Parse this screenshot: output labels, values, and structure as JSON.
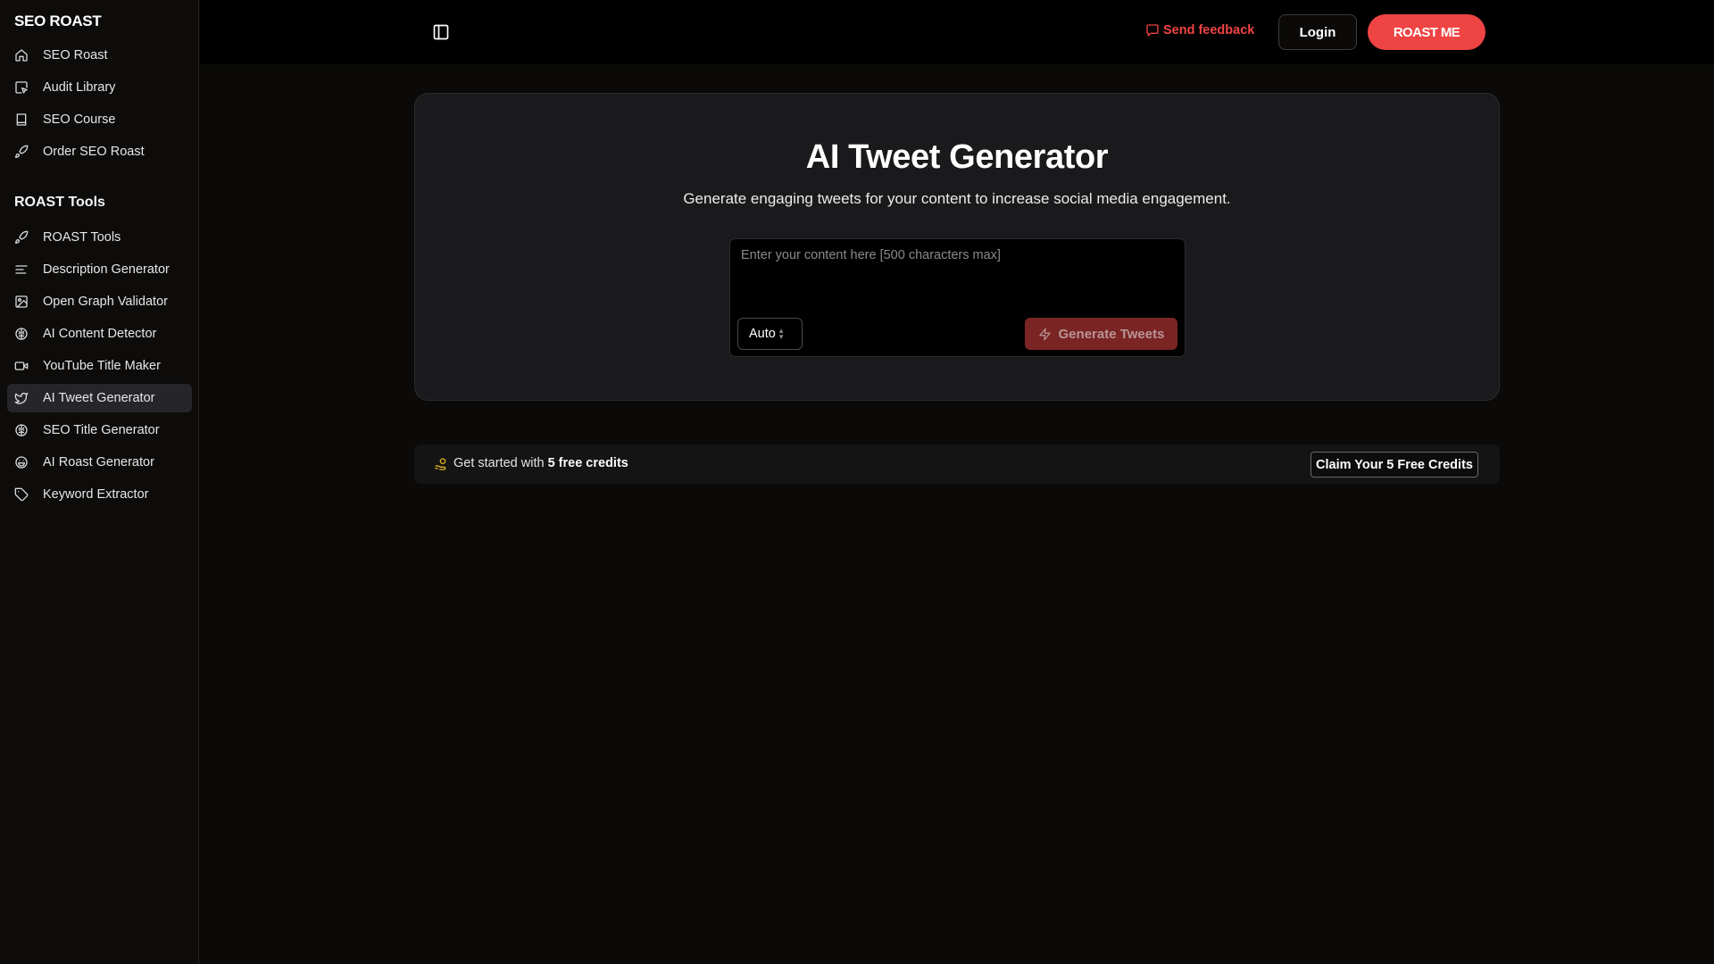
{
  "sidebar": {
    "brand": "SEO ROAST",
    "main_items": [
      {
        "label": "SEO Roast",
        "icon": "home-icon"
      },
      {
        "label": "Audit Library",
        "icon": "cursor-square-icon"
      },
      {
        "label": "SEO Course",
        "icon": "book-icon"
      },
      {
        "label": "Order SEO Roast",
        "icon": "rocket-icon"
      }
    ],
    "section_title": "ROAST Tools",
    "tool_items": [
      {
        "label": "ROAST Tools",
        "icon": "rocket-icon",
        "active": false
      },
      {
        "label": "Description Generator",
        "icon": "align-left-icon",
        "active": false
      },
      {
        "label": "Open Graph Validator",
        "icon": "image-icon",
        "active": false
      },
      {
        "label": "AI Content Detector",
        "icon": "brain-icon",
        "active": false
      },
      {
        "label": "YouTube Title Maker",
        "icon": "video-icon",
        "active": false
      },
      {
        "label": "AI Tweet Generator",
        "icon": "twitter-icon",
        "active": true
      },
      {
        "label": "SEO Title Generator",
        "icon": "brain-icon",
        "active": false
      },
      {
        "label": "AI Roast Generator",
        "icon": "laugh-icon",
        "active": false
      },
      {
        "label": "Keyword Extractor",
        "icon": "tag-icon",
        "active": false
      }
    ]
  },
  "header": {
    "toggle_icon": "sidebar-toggle-icon",
    "feedback_label": "Send feedback",
    "feedback_icon": "message-square-icon",
    "login_label": "Login",
    "cta_label": "ROAST ME"
  },
  "colors": {
    "accent": "#ef4444",
    "button_disabled": "#7a2424",
    "card_bg": "#1a1a1c",
    "page_bg": "#0b0a09",
    "coin": "#e0b020"
  },
  "tool": {
    "title": "AI Tweet Generator",
    "subtitle": "Generate engaging tweets for your content to increase social media engagement.",
    "input": {
      "value": "",
      "placeholder": "Enter your content here [500 characters max]"
    },
    "tone_select": {
      "selected": "Auto"
    },
    "generate_label": "Generate Tweets",
    "generate_icon": "zap-icon"
  },
  "banner": {
    "icon": "coin-hand-icon",
    "prefix": "Get started with ",
    "highlight": "5 free credits",
    "claim_label": "Claim Your 5 Free Credits"
  }
}
